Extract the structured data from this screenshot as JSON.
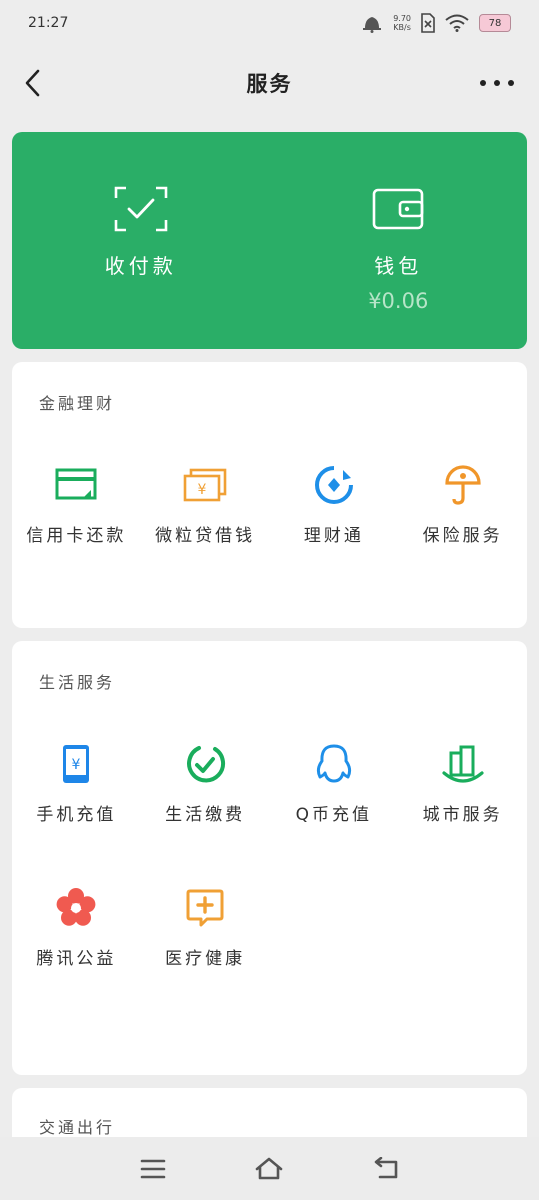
{
  "status_bar": {
    "time": "21:27",
    "net_speed_value": "9.70",
    "net_speed_unit": "KB/s",
    "battery": "78"
  },
  "nav": {
    "title": "服务"
  },
  "wallet_card": {
    "pay": {
      "label": "收付款"
    },
    "wallet": {
      "label": "钱包",
      "balance": "¥0.06"
    }
  },
  "sections": {
    "finance": {
      "title": "金融理财",
      "items": [
        {
          "label": "信用卡还款",
          "icon": "credit-card-icon",
          "color": "#1aad5c"
        },
        {
          "label": "微粒贷借钱",
          "icon": "loan-bills-icon",
          "color": "#f0a035"
        },
        {
          "label": "理财通",
          "icon": "wealth-icon",
          "color": "#1e8fe8"
        },
        {
          "label": "保险服务",
          "icon": "insurance-icon",
          "color": "#f0962a"
        }
      ]
    },
    "life": {
      "title": "生活服务",
      "items": [
        {
          "label": "手机充值",
          "icon": "mobile-topup-icon",
          "color": "#1e86e8"
        },
        {
          "label": "生活缴费",
          "icon": "utility-bill-icon",
          "color": "#1aad5c"
        },
        {
          "label": "Q币充值",
          "icon": "qq-penguin-icon",
          "color": "#1e8fe8"
        },
        {
          "label": "城市服务",
          "icon": "city-buildings-icon",
          "color": "#1aad5c"
        },
        {
          "label": "腾讯公益",
          "icon": "charity-flower-icon",
          "color": "#f05a50"
        },
        {
          "label": "医疗健康",
          "icon": "medical-cross-icon",
          "color": "#f0a035"
        }
      ]
    },
    "transport": {
      "title": "交通出行"
    }
  }
}
